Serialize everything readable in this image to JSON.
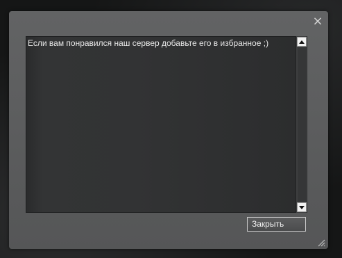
{
  "dialog": {
    "close_glyph": "×",
    "message": "Если вам понравился наш сервер добавьте его в избранное ;)",
    "close_button_label": "Закрыть",
    "scroll_up_icon": "arrow-up-icon",
    "scroll_down_icon": "arrow-down-icon",
    "resize_icon": "resize-grip-icon"
  }
}
